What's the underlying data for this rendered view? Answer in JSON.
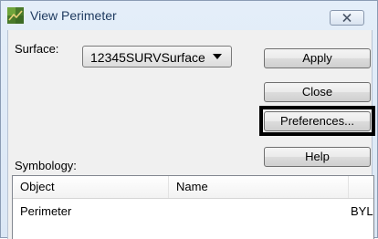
{
  "window": {
    "title": "View Perimeter",
    "icon": "app-icon",
    "close_icon": "close-icon"
  },
  "surface": {
    "label": "Surface:",
    "selected": "12345SURVSurface"
  },
  "buttons": {
    "apply": "Apply",
    "close": "Close",
    "preferences": "Preferences...",
    "help": "Help"
  },
  "symbology": {
    "label": "Symbology:",
    "columns": [
      "Object",
      "Name"
    ],
    "rows": [
      {
        "object": "Perimeter",
        "name": "",
        "extra": "BYL"
      }
    ]
  },
  "colors": {
    "title_text": "#1e3a5f",
    "highlight_border": "#000000"
  }
}
